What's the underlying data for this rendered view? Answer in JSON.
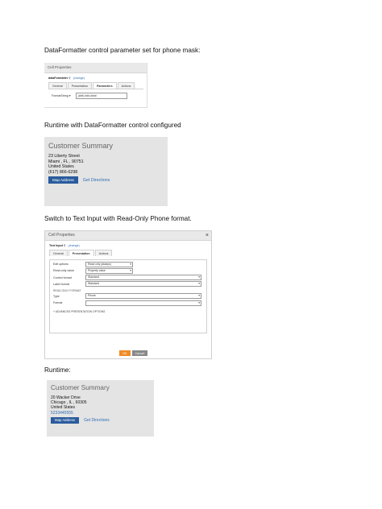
{
  "headings": {
    "h1": "DataFormatter control parameter set for phone mask:",
    "h2": "Runtime with DataFormatter control configured",
    "h3": "Switch to Text Input with Read-Only Phone format.",
    "h4": "Runtime:"
  },
  "dialog1": {
    "title": "Cell Properties",
    "control_name": "dataFormatter",
    "change_link": "(change)",
    "tabs": [
      "General",
      "Presentation",
      "Parameters",
      "Actions"
    ],
    "active_tab": 2,
    "field_label": "FormatString",
    "field_value": "(###) ###-####"
  },
  "summary1": {
    "title": "Customer Summary",
    "street": "23 Liberty Street",
    "city_line": "Miami , FL , 90751",
    "country": "United States",
    "phone": "(617) 866-6298",
    "map_button": "Map Address",
    "directions_link": "Get Directions"
  },
  "dialog2": {
    "title": "Cell Properties",
    "close_glyph": "×",
    "control_name": "Text Input",
    "change_link": "(change)",
    "tabs": [
      "General",
      "Presentation",
      "Actions"
    ],
    "active_tab": 1,
    "rows": [
      {
        "label": "Edit options",
        "value": "Read only (always)"
      },
      {
        "label": "Read-only value",
        "value": "Property value"
      },
      {
        "label": "Control format",
        "value": "Standard"
      },
      {
        "label": "Label format",
        "value": "Standard"
      }
    ],
    "section_label": "READ-ONLY FORMAT",
    "type_label": "Type",
    "type_value": "Phone",
    "format_label": "Format",
    "format_value": "",
    "advanced": "+ ADVANCED PRESENTATION OPTIONS",
    "ok_label": "OK",
    "cancel_label": "Cancel"
  },
  "summary2": {
    "title": "Customer Summary",
    "street": "20 Wacker Drive",
    "city_line": "Chicago , IL , 60305",
    "country": "United States",
    "phone": "5233445555",
    "map_button": "Map Address",
    "directions_link": "Get Directions"
  }
}
